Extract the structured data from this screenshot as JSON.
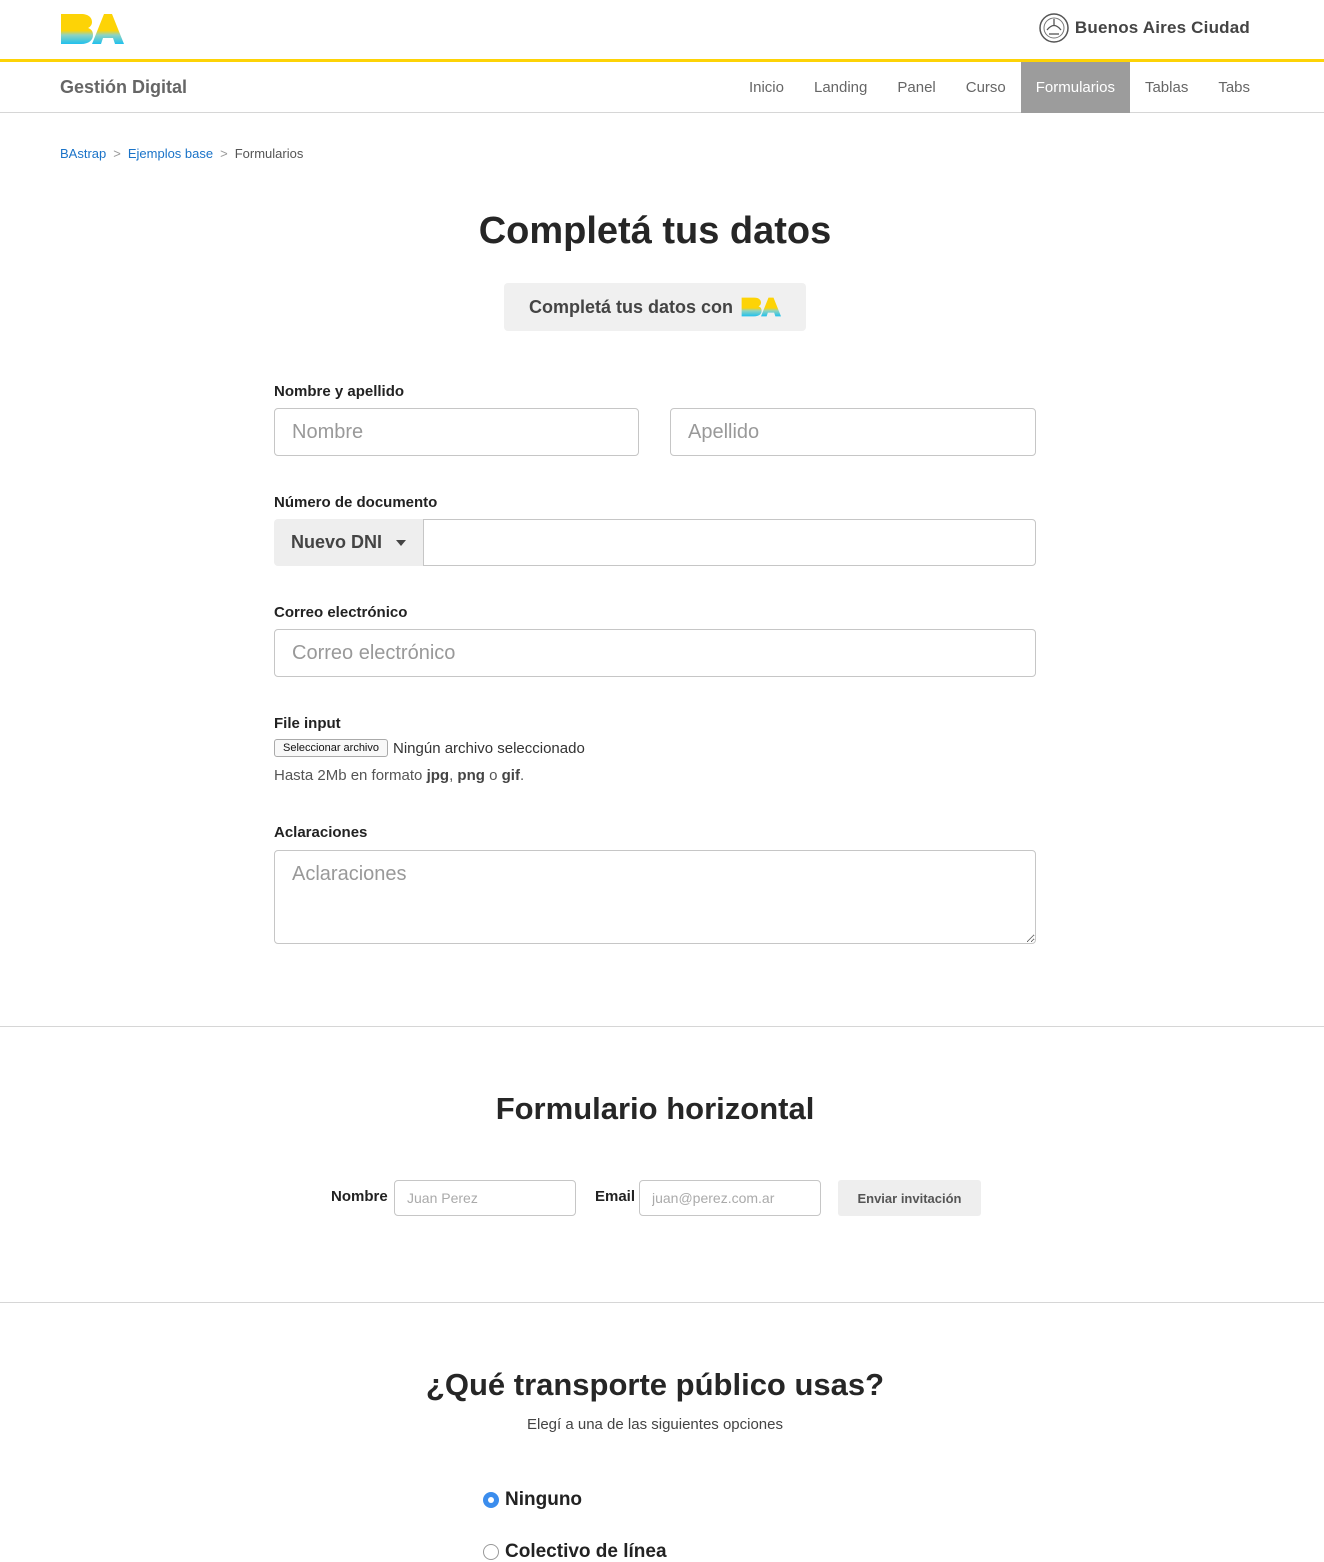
{
  "header": {
    "logo_text": "BA",
    "city_name": "Buenos Aires Ciudad"
  },
  "navbar": {
    "brand": "Gestión Digital",
    "items": [
      {
        "label": "Inicio",
        "active": false
      },
      {
        "label": "Landing",
        "active": false
      },
      {
        "label": "Panel",
        "active": false
      },
      {
        "label": "Curso",
        "active": false
      },
      {
        "label": "Formularios",
        "active": true
      },
      {
        "label": "Tablas",
        "active": false
      },
      {
        "label": "Tabs",
        "active": false
      }
    ]
  },
  "breadcrumb": {
    "items": [
      "BAstrap",
      "Ejemplos base",
      "Formularios"
    ],
    "separator": ">"
  },
  "form_main": {
    "title": "Completá tus datos",
    "ba_button_label": "Completá tus datos con",
    "name_label": "Nombre y apellido",
    "first_name_placeholder": "Nombre",
    "last_name_placeholder": "Apellido",
    "doc_label": "Número de documento",
    "doc_type_selected": "Nuevo DNI",
    "doc_value": "",
    "email_label": "Correo electrónico",
    "email_placeholder": "Correo electrónico",
    "file_label": "File input",
    "file_button": "Seleccionar archivo",
    "file_status": "Ningún archivo seleccionado",
    "file_help_prefix": "Hasta 2Mb en formato",
    "file_help_fmt1": "jpg",
    "file_help_sep": ",",
    "file_help_fmt2": "png",
    "file_help_or": "o",
    "file_help_fmt3": "gif",
    "file_help_end": ".",
    "notes_label": "Aclaraciones",
    "notes_placeholder": "Aclaraciones"
  },
  "form_horizontal": {
    "title": "Formulario horizontal",
    "name_label": "Nombre",
    "name_placeholder": "Juan Perez",
    "email_label": "Email",
    "email_placeholder": "juan@perez.com.ar",
    "submit_label": "Enviar invitación"
  },
  "transport": {
    "title": "¿Qué transporte público usas?",
    "subtitle": "Elegí a una de las siguientes opciones",
    "options": [
      {
        "label": "Ninguno",
        "checked": true
      },
      {
        "label": "Colectivo de línea",
        "checked": false
      }
    ]
  },
  "colors": {
    "accent_yellow": "#fdd306",
    "link_blue": "#1a73c8",
    "radio_blue": "#3b8ded",
    "nav_active_bg": "#9c9c9c"
  }
}
